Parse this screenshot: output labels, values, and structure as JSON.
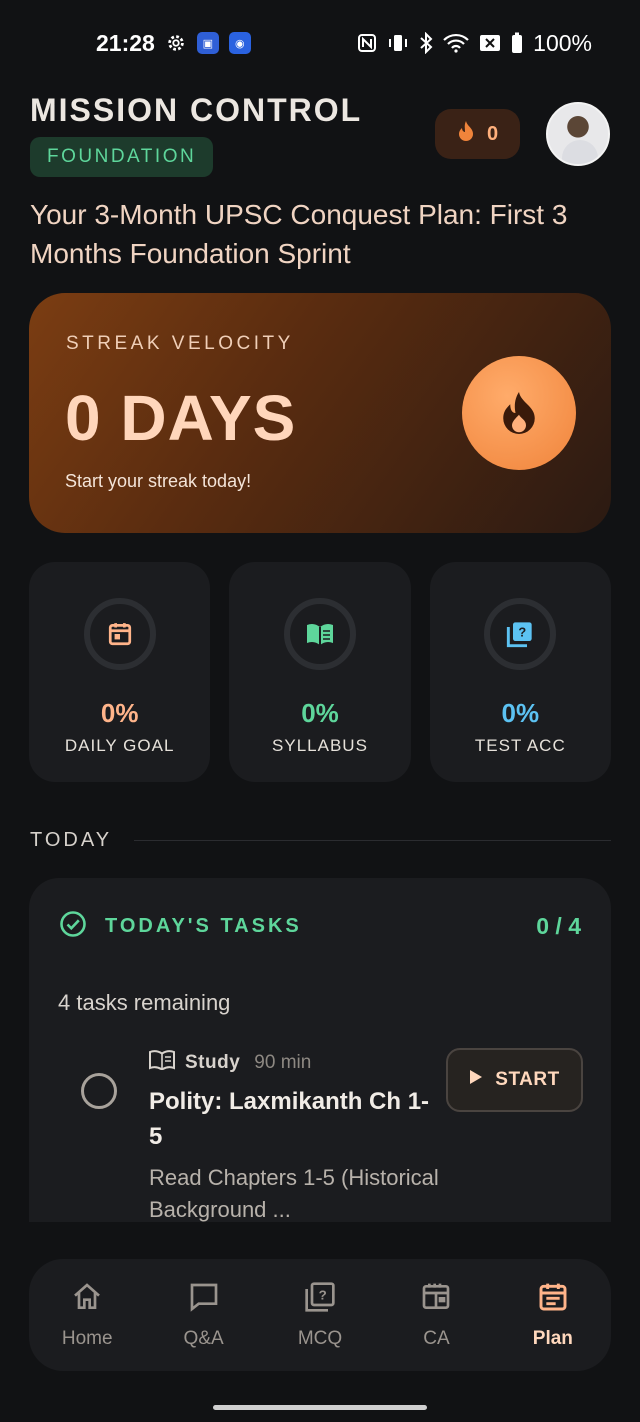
{
  "status_bar": {
    "time": "21:28",
    "battery": "100%",
    "icons": [
      "gear-icon",
      "app-icon",
      "broadcast-icon",
      "nfc-icon",
      "vibrate-icon",
      "bluetooth-icon",
      "wifi-icon",
      "no-sim-icon",
      "battery-icon"
    ]
  },
  "header": {
    "title": "MISSION CONTROL",
    "badge": "FOUNDATION",
    "streak_count": "0",
    "plan_title": "Your 3-Month UPSC Conquest Plan: First 3 Months Foundation Sprint"
  },
  "hero": {
    "label": "STREAK VELOCITY",
    "value": "0 DAYS",
    "subtitle": "Start your streak today!"
  },
  "stats": [
    {
      "value": "0%",
      "label": "DAILY GOAL",
      "color": "#ffb48a",
      "icon": "calendar-icon"
    },
    {
      "value": "0%",
      "label": "SYLLABUS",
      "color": "#5ed69b",
      "icon": "book-open-icon"
    },
    {
      "value": "0%",
      "label": "TEST ACC",
      "color": "#5cc2f2",
      "icon": "quiz-icon"
    }
  ],
  "today": {
    "section_label": "TODAY",
    "card_title": "TODAY'S TASKS",
    "count": "0 / 4",
    "remaining": "4 tasks remaining",
    "task": {
      "type": "Study",
      "duration": "90 min",
      "title": "Polity: Laxmikanth Ch 1-5",
      "description": "Read Chapters 1-5 (Historical Background ...",
      "action": "START"
    }
  },
  "nav": [
    {
      "label": "Home",
      "icon": "home-icon"
    },
    {
      "label": "Q&A",
      "icon": "chat-icon"
    },
    {
      "label": "MCQ",
      "icon": "quiz-icon"
    },
    {
      "label": "CA",
      "icon": "newspaper-icon"
    },
    {
      "label": "Plan",
      "icon": "calendar-icon",
      "active": true
    }
  ]
}
